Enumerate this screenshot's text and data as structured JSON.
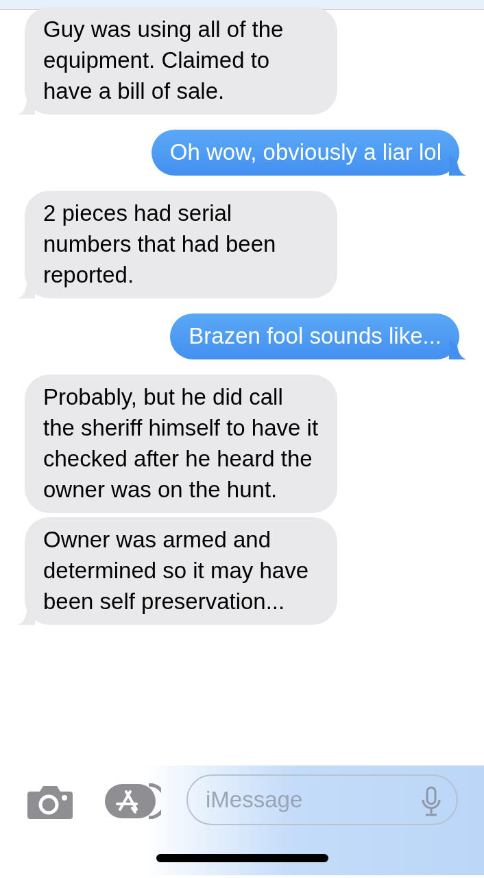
{
  "messages": [
    {
      "kind": "incoming",
      "text": "Guy was using all of the equipment. Claimed to have a bill of sale."
    },
    {
      "kind": "outgoing",
      "text": "Oh wow, obviously a liar lol"
    },
    {
      "kind": "incoming",
      "text": "2 pieces had serial numbers that had been reported."
    },
    {
      "kind": "outgoing",
      "text": "Brazen fool sounds like..."
    },
    {
      "kind": "incoming",
      "text": "Probably, but he did call the sheriff himself to have it checked after he heard the owner was on the hunt."
    },
    {
      "kind": "incoming",
      "text": "Owner was armed and determined so it may have been self preservation..."
    }
  ],
  "input": {
    "placeholder": "iMessage"
  }
}
